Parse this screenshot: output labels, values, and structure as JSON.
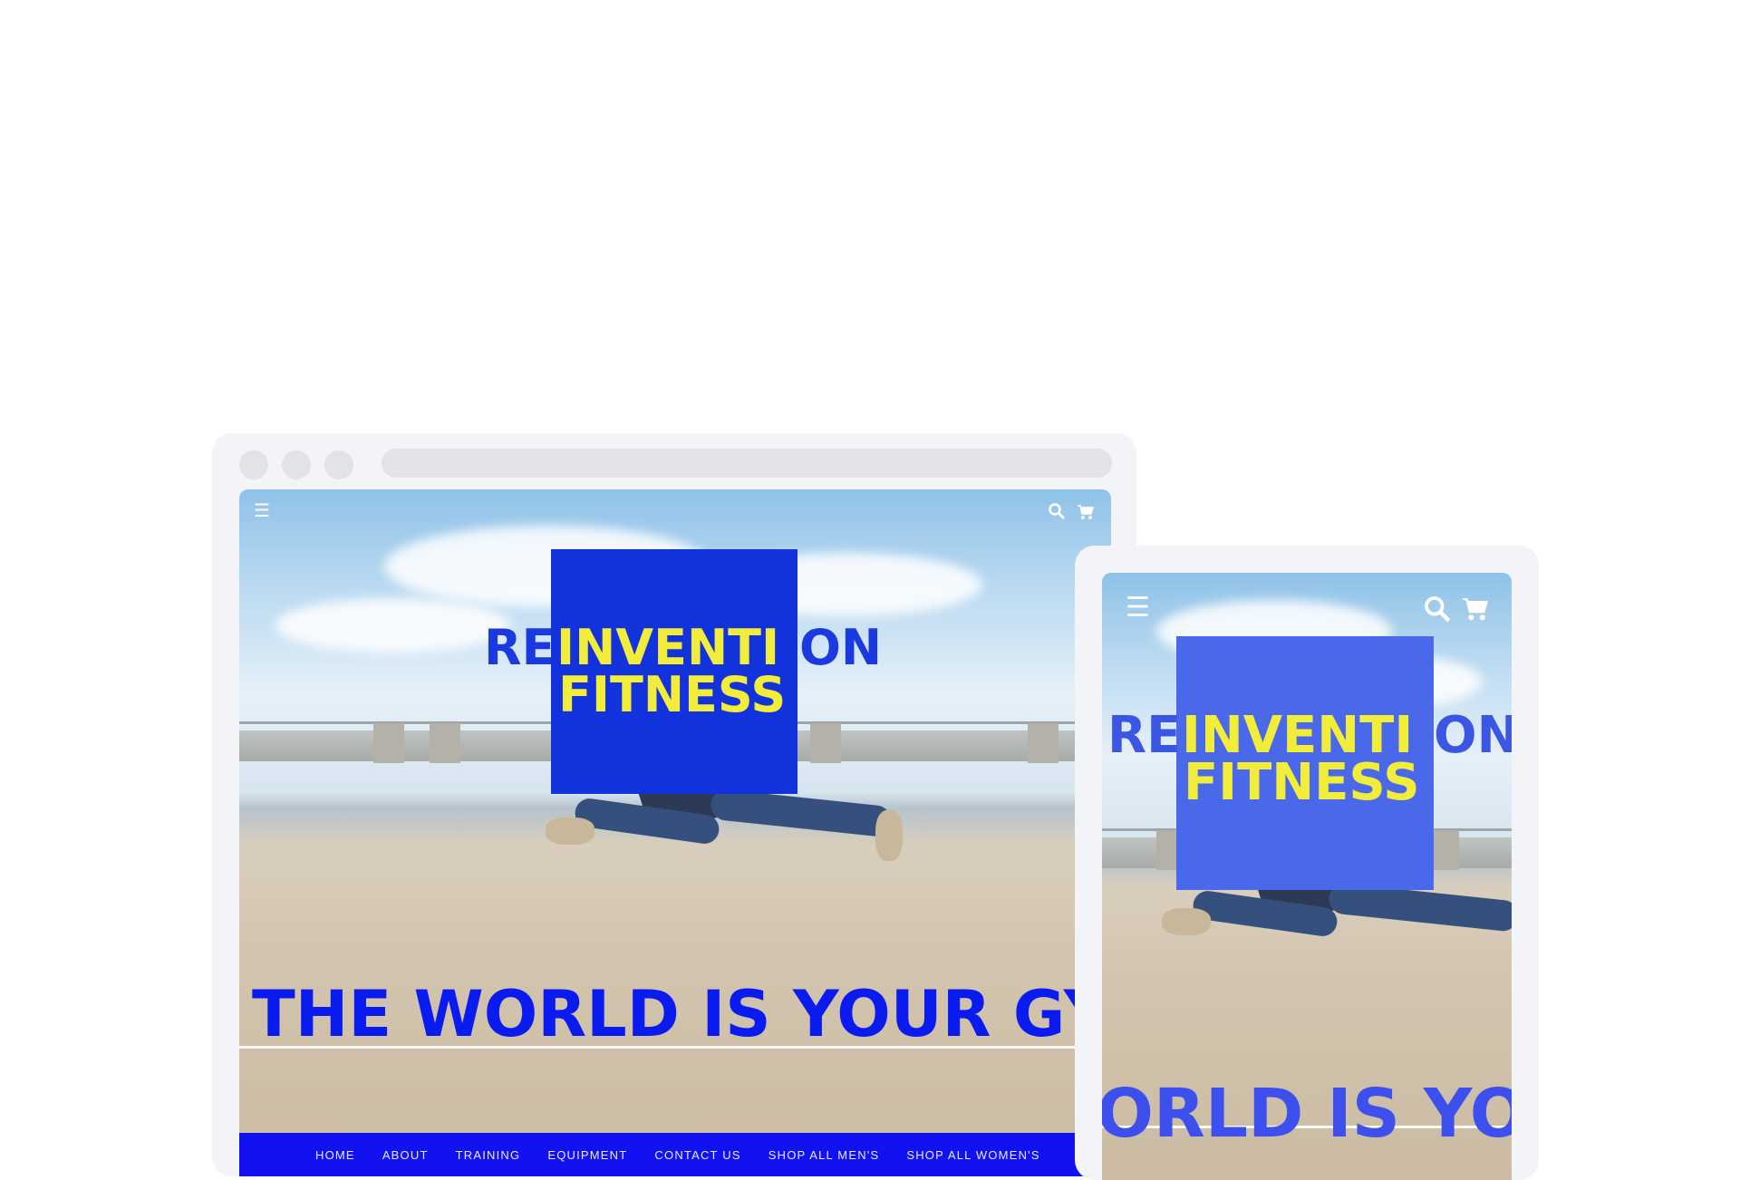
{
  "desktop": {
    "logo": {
      "line1_left": "RE",
      "line1_middle": "INVENTI",
      "line1_right": "ON",
      "line2": "FITNESS"
    },
    "hero_text": "THE WORLD IS YOUR GYM",
    "menu_icon": "hamburger-menu-icon",
    "search_icon": "search-icon",
    "cart_icon": "cart-icon",
    "nav_items": [
      "HOME",
      "ABOUT",
      "TRAINING",
      "EQUIPMENT",
      "CONTACT US",
      "SHOP ALL MEN'S",
      "SHOP ALL WOMEN'S"
    ]
  },
  "mobile": {
    "logo": {
      "line1_left": "RE",
      "line1_middle": "INVENTI",
      "line1_right": "ON",
      "line2": "FITNESS"
    },
    "hero_text": "ORLD IS YOU",
    "menu_icon": "hamburger-menu-icon",
    "search_icon": "search-icon",
    "cart_icon": "cart-icon"
  },
  "colors": {
    "brand_blue": "#1232dc",
    "brand_yellow": "#f2ec3a",
    "nav_blue": "#1212f0",
    "frame_gray": "#f3f4f7"
  }
}
